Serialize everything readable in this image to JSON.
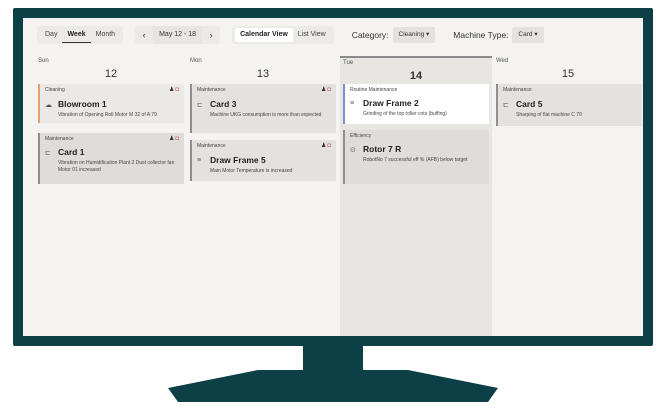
{
  "toolbar": {
    "range_buttons": [
      "Day",
      "Week",
      "Month"
    ],
    "prev": "‹",
    "date_range": "May 12 - 18",
    "next": "›",
    "view_buttons": [
      "Calendar View",
      "List View"
    ],
    "category_label": "Category:",
    "category_value": "Cleaning ▾",
    "machine_label": "Machine Type:",
    "machine_value": "Card ▾"
  },
  "days": [
    {
      "name": "Sun",
      "num": "12"
    },
    {
      "name": "Mon",
      "num": "13"
    },
    {
      "name": "Tue",
      "num": "14"
    },
    {
      "name": "Wed",
      "num": "15"
    }
  ],
  "cards": [
    {
      "category": "Cleaning",
      "icon": "☁",
      "title": "Blowroom 1",
      "desc": "Vibration of Opening Roll Motor M 32 of A 79"
    },
    {
      "category": "Maintenance",
      "icon": "⊏",
      "title": "Card 1",
      "desc": "Vibration on Humidification Plant 2 Dust collector fan Motor 01 increased"
    },
    {
      "category": "Maintenance",
      "icon": "⊏",
      "title": "Card 3",
      "desc": "Machine UKG consumption is more than expected"
    },
    {
      "category": "Maintenance",
      "icon": "≡",
      "title": "Draw Frame 5",
      "desc": "Main Motor Temperature is increased"
    },
    {
      "category": "Routine Maintenance",
      "icon": "≡",
      "title": "Draw Frame 2",
      "desc": "Grinding of the top roller cots (buffing)"
    },
    {
      "category": "Efficiency",
      "icon": "⊙",
      "title": "Rotor 7 R",
      "desc": "RobotNo 7 successful eff % (AFB) below target"
    },
    {
      "category": "Maintenance",
      "icon": "⊏",
      "title": "Card 5",
      "desc": "Sharping of flat machine C 70"
    }
  ],
  "icons": {
    "person": "person-icon",
    "alert": "alert-icon"
  },
  "colors": {
    "frame": "#0d3f47",
    "screen": "#f4f3f1",
    "cleaning_accent": "#e4a06d",
    "routine_accent": "#7d8fd0",
    "alert": "#d9534f"
  }
}
